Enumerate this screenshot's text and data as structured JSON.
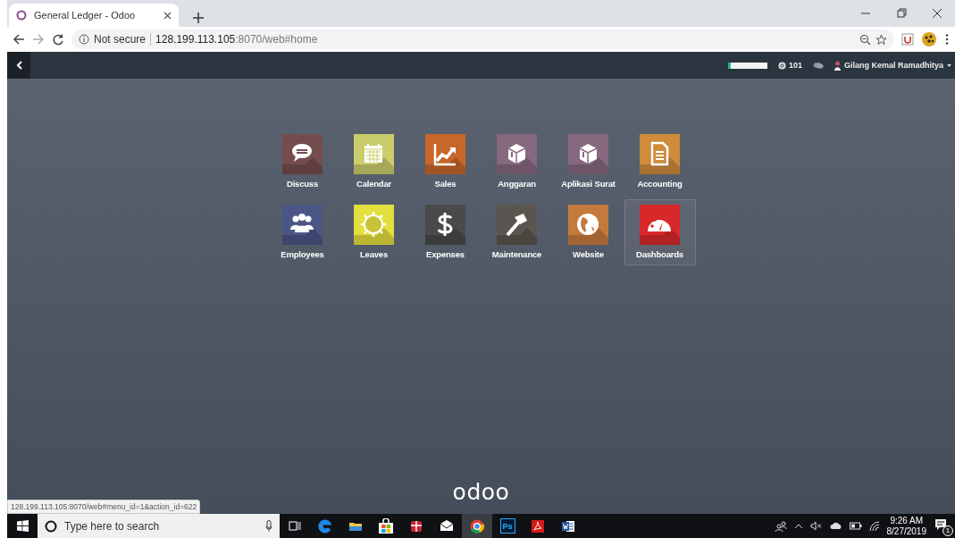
{
  "browser": {
    "tab_title": "General Ledger - Odoo",
    "address_security": "Not secure",
    "address_host": "128.199.113.105",
    "address_path": ":8070/web#home"
  },
  "navbar": {
    "progress": {
      "level": 0.08
    },
    "notification_count": "101",
    "user_name": "Gilang Kemal Ramadhitya"
  },
  "apps": [
    {
      "label": "Discuss",
      "color": "#744c4e",
      "selected": false
    },
    {
      "label": "Calendar",
      "color": "#c9cd6c",
      "selected": false
    },
    {
      "label": "Sales",
      "color": "#c8672a",
      "selected": false
    },
    {
      "label": "Anggaran",
      "color": "#86687f",
      "selected": false
    },
    {
      "label": "Aplikasi Surat",
      "color": "#86687f",
      "selected": false
    },
    {
      "label": "Accounting",
      "color": "#cf8c3b",
      "selected": false
    },
    {
      "label": "Employees",
      "color": "#4b5686",
      "selected": false
    },
    {
      "label": "Leaves",
      "color": "#e4df3e",
      "selected": false
    },
    {
      "label": "Expenses",
      "color": "#4a4a4a",
      "selected": false
    },
    {
      "label": "Maintenance",
      "color": "#5a554e",
      "selected": false
    },
    {
      "label": "Website",
      "color": "#c57a3d",
      "selected": false
    },
    {
      "label": "Dashboards",
      "color": "#d8282a",
      "selected": true
    }
  ],
  "logo": "odoo",
  "status_link": "128.199.113.105:8070/web#menu_id=1&action_id=622",
  "taskbar": {
    "search_placeholder": "Type here to search",
    "apps": [
      {
        "kind": "taskview",
        "active": false
      },
      {
        "kind": "edge",
        "active": false
      },
      {
        "kind": "folder",
        "active": false
      },
      {
        "kind": "store",
        "active": false
      },
      {
        "kind": "gift",
        "active": false
      },
      {
        "kind": "mail",
        "active": false
      },
      {
        "kind": "chrome",
        "active": true
      },
      {
        "kind": "photoshop",
        "label": "Ps",
        "active": false
      },
      {
        "kind": "pdf",
        "active": false
      },
      {
        "kind": "word",
        "active": false
      }
    ],
    "time": "9:26 AM",
    "date": "8/27/2019",
    "notification_badge": "1"
  }
}
